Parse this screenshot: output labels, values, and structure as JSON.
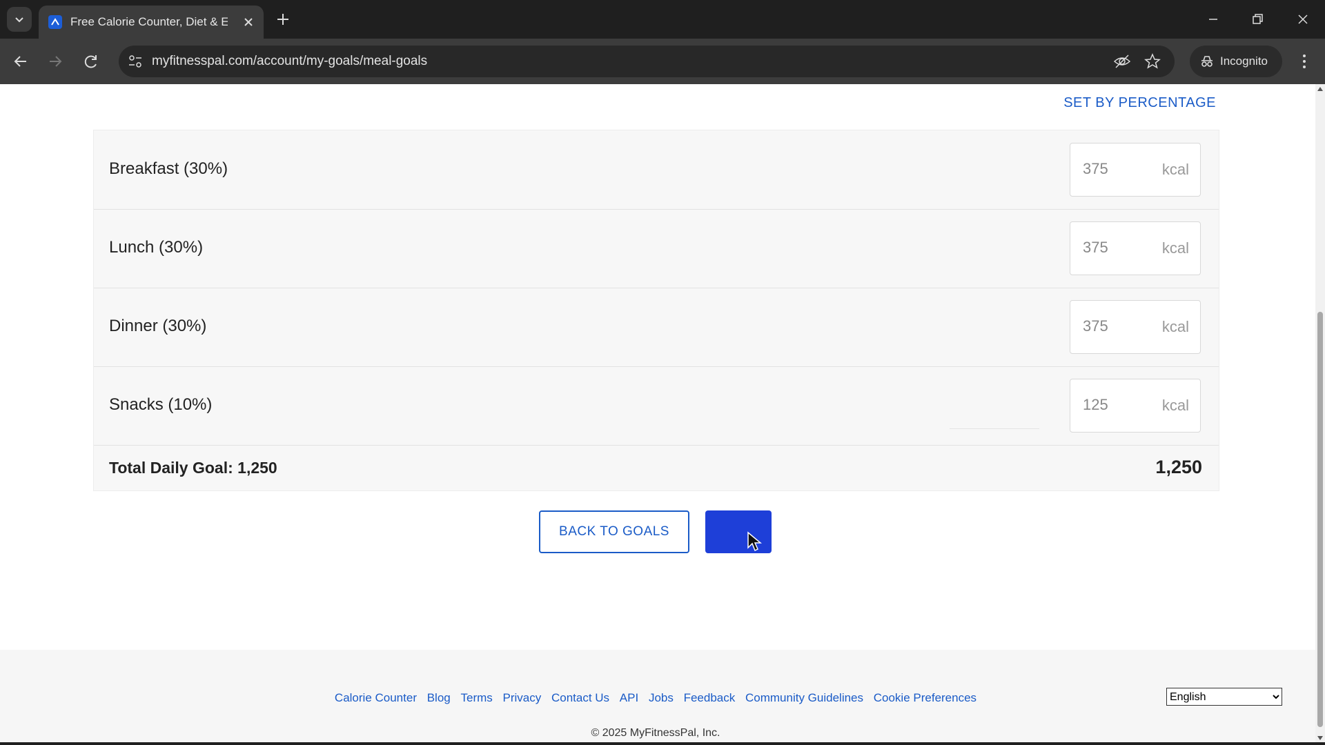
{
  "browser": {
    "tab_title": "Free Calorie Counter, Diet & Exe",
    "favicon_letter": "⨯",
    "url": "myfitnesspal.com/account/my-goals/meal-goals",
    "incognito_label": "Incognito"
  },
  "page": {
    "set_by_percentage": "SET BY PERCENTAGE",
    "meals": [
      {
        "label": "Breakfast (30%)",
        "value": "375",
        "unit": "kcal"
      },
      {
        "label": "Lunch (30%)",
        "value": "375",
        "unit": "kcal"
      },
      {
        "label": "Dinner (30%)",
        "value": "375",
        "unit": "kcal"
      },
      {
        "label": "Snacks (10%)",
        "value": "125",
        "unit": "kcal"
      }
    ],
    "total_label": "Total Daily Goal: 1,250",
    "total_value": "1,250",
    "back_button": "BACK TO GOALS",
    "save_button": ""
  },
  "footer": {
    "links": [
      "Calorie Counter",
      "Blog",
      "Terms",
      "Privacy",
      "Contact Us",
      "API",
      "Jobs",
      "Feedback",
      "Community Guidelines",
      "Cookie Preferences"
    ],
    "language": "English",
    "copyright": "© 2025 MyFitnessPal, Inc."
  },
  "colors": {
    "accent_blue": "#1a5bc7",
    "save_blue": "#1e3fd8"
  }
}
